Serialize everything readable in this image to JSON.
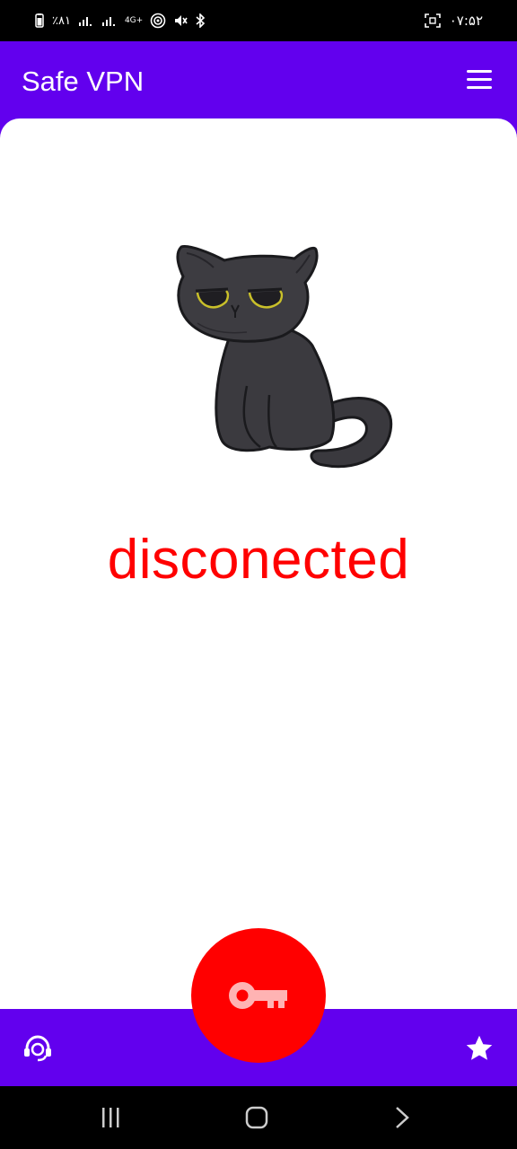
{
  "status_bar": {
    "battery_percent": "٪۸۱",
    "network_type": "4G+",
    "time": "۰۷:۵۲"
  },
  "app_bar": {
    "title": "Safe VPN",
    "menu_icon": "menu-icon"
  },
  "main": {
    "illustration": "sad-cat-illustration",
    "connection_status": "disconected",
    "status_color": "#ff0000"
  },
  "bottom_bar": {
    "left_icon": "support-agent-icon",
    "right_icon": "star-icon",
    "connect_button_icon": "key-icon"
  },
  "colors": {
    "primary": "#6200ee",
    "accent": "#ff0000",
    "background": "#ffffff"
  },
  "system_nav": {
    "recents_icon": "recents-icon",
    "home_icon": "home-icon",
    "back_icon": "back-icon"
  }
}
